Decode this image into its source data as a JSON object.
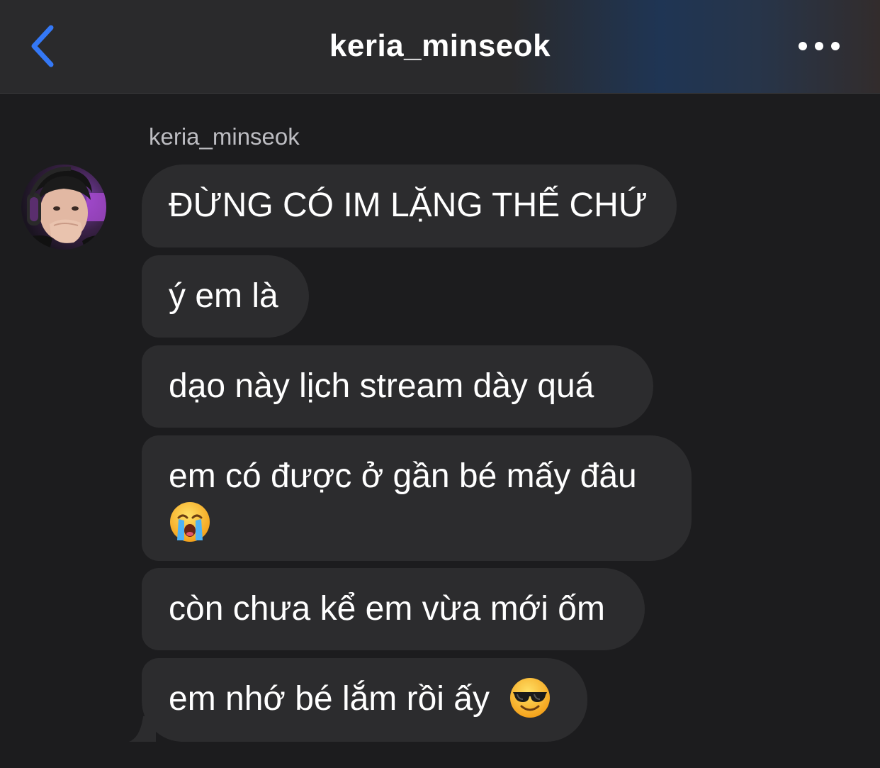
{
  "header": {
    "title": "keria_minseok",
    "back_icon": "chevron-left-icon",
    "more_icon": "more-horizontal-icon",
    "accent_color": "#3478f6"
  },
  "conversation": {
    "sender_name": "keria_minseok",
    "messages": [
      {
        "text": "ĐỪNG CÓ IM LẶNG THẾ CHỨ"
      },
      {
        "text": "ý em là"
      },
      {
        "text": "dạo này lịch stream dày quá"
      },
      {
        "text": "em có được ở gần bé mấy đâu",
        "emoji": "loudly-crying-face-emoji"
      },
      {
        "text": "còn chưa kể em vừa mới ốm"
      },
      {
        "text": "em nhớ bé lắm rồi ấy",
        "emoji": "smiling-face-with-sunglasses-emoji"
      }
    ]
  },
  "colors": {
    "background": "#1c1c1e",
    "bubble": "#2c2c2e",
    "text": "#ffffff"
  }
}
